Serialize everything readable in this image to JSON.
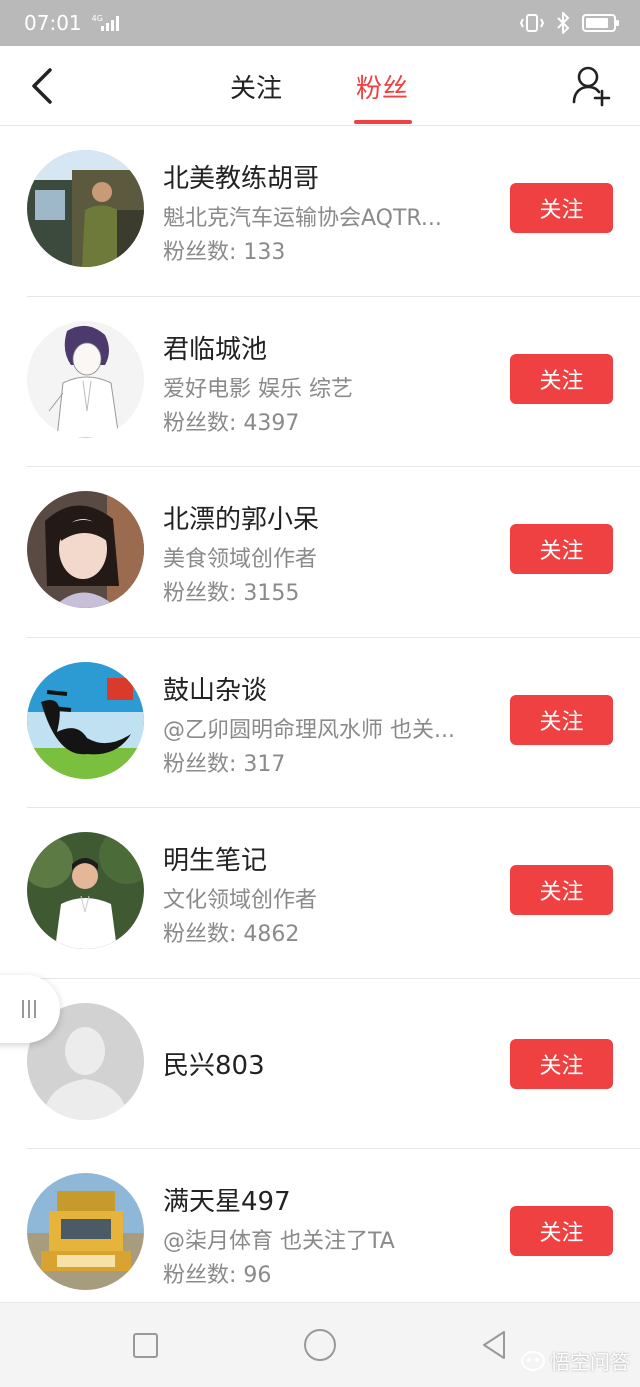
{
  "status_bar": {
    "time": "07:01",
    "network": "4G"
  },
  "header": {
    "tabs": [
      {
        "label": "关注",
        "active": false
      },
      {
        "label": "粉丝",
        "active": true
      }
    ],
    "accent_color": "#f04142"
  },
  "fans": [
    {
      "name": "北美教练胡哥",
      "desc": "魁北克汽车运输协会AQTR...",
      "fans_count": "粉丝数: 133",
      "follow_label": "关注"
    },
    {
      "name": "君临城池",
      "desc": "爱好电影 娱乐 综艺",
      "fans_count": "粉丝数: 4397",
      "follow_label": "关注"
    },
    {
      "name": "北漂的郭小呆",
      "desc": "美食领域创作者",
      "fans_count": "粉丝数: 3155",
      "follow_label": "关注"
    },
    {
      "name": "鼓山杂谈",
      "desc": "@乙卯圆明命理风水师 也关...",
      "fans_count": "粉丝数: 317",
      "follow_label": "关注"
    },
    {
      "name": "明生笔记",
      "desc": "文化领域创作者",
      "fans_count": "粉丝数: 4862",
      "follow_label": "关注"
    },
    {
      "name": "民兴803",
      "follow_label": "关注"
    },
    {
      "name": "满天星497",
      "desc": "@柒月体育 也关注了TA",
      "fans_count": "粉丝数: 96",
      "follow_label": "关注"
    }
  ],
  "watermark": "悟空问答"
}
